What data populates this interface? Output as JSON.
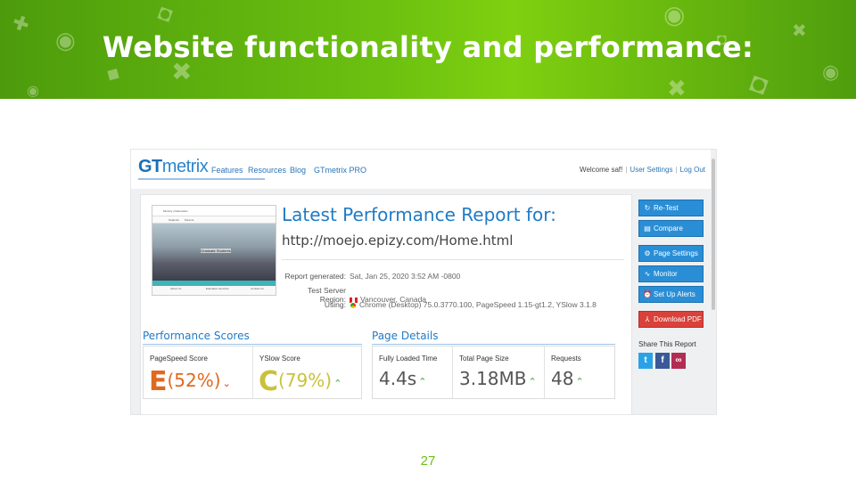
{
  "slide": {
    "title": "Website functionality and performance:",
    "page_number": "27"
  },
  "gtmetrix": {
    "logo_gt": "GT",
    "logo_metrix": "metrix",
    "nav": [
      "Features",
      "Resources",
      "Blog",
      "GTmetrix PRO"
    ],
    "welcome": "Welcome saf!",
    "user_settings": "User Settings",
    "log_out": "Log Out",
    "report_title": "Latest Performance Report for:",
    "report_url": "http://moejo.epizy.com/Home.html",
    "meta": {
      "generated_label": "Report generated:",
      "generated_value": "Sat, Jan 25, 2020 3:52 AM -0800",
      "region_label": "Test Server Region:",
      "region_value": "Vancouver, Canada",
      "using_label": "Using:",
      "using_value": "Chrome (Desktop) 75.0.3770.100, PageSpeed 1.15-gt1.2, YSlow 3.1.8"
    },
    "thumbnail": {
      "site_name": "Ministry of Education",
      "nav_1": "Students",
      "nav_2": "Parents",
      "banner_text": "Graduate Students",
      "foot_1": "About Us",
      "foot_2": "Education Services",
      "foot_3": "Contact Us"
    },
    "performance_scores": {
      "title": "Performance Scores",
      "pagespeed_label": "PageSpeed Score",
      "pagespeed_grade": "E",
      "pagespeed_pct": "(52%)",
      "yslow_label": "YSlow Score",
      "yslow_grade": "C",
      "yslow_pct": "(79%)",
      "pagespeed_color": "#e0691f",
      "yslow_color": "#c9c23a"
    },
    "page_details": {
      "title": "Page Details",
      "load_label": "Fully Loaded Time",
      "load_value": "4.4s",
      "size_label": "Total Page Size",
      "size_value": "3.18MB",
      "requests_label": "Requests",
      "requests_value": "48"
    },
    "sidebar": {
      "retest": "Re-Test",
      "compare": "Compare",
      "page_settings": "Page Settings",
      "monitor": "Monitor",
      "alerts": "Set Up Alerts",
      "pdf": "Download PDF",
      "share": "Share This Report"
    }
  }
}
